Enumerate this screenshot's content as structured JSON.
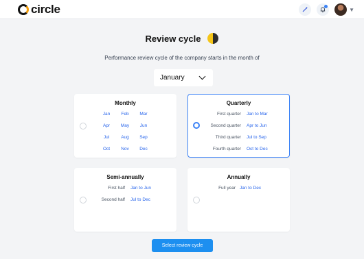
{
  "app": {
    "logo_text": "circle"
  },
  "header": {
    "icons": [
      "magic-wand-icon",
      "bell-icon",
      "avatar",
      "chevron-down-icon"
    ]
  },
  "page": {
    "title": "Review cycle",
    "subtitle": "Performance review cycle of the company starts in the month of",
    "month_select": {
      "value": "January"
    }
  },
  "cards": {
    "monthly": {
      "title": "Monthly",
      "selected": false,
      "months": [
        "Jan",
        "Feb",
        "Mar",
        "Apr",
        "May",
        "Jun",
        "Jul",
        "Aug",
        "Sep",
        "Oct",
        "Nov",
        "Dec"
      ]
    },
    "quarterly": {
      "title": "Quarterly",
      "selected": true,
      "rows": [
        {
          "label": "First quarter",
          "value": "Jan to Mar"
        },
        {
          "label": "Second quarter",
          "value": "Apr to Jun"
        },
        {
          "label": "Third quarter",
          "value": "Jul to Sep"
        },
        {
          "label": "Fourth quarter",
          "value": "Oct to Dec"
        }
      ]
    },
    "semi_annually": {
      "title": "Semi-annually",
      "selected": false,
      "rows": [
        {
          "label": "First half",
          "value": "Jan to Jun"
        },
        {
          "label": "Second half",
          "value": "Jul to Dec"
        }
      ]
    },
    "annually": {
      "title": "Annually",
      "selected": false,
      "rows": [
        {
          "label": "Full year",
          "value": "Jan to Dec"
        }
      ]
    }
  },
  "actions": {
    "submit_label": "Select review cycle"
  },
  "colors": {
    "accent": "#1d8ff0",
    "link": "#2563eb"
  }
}
